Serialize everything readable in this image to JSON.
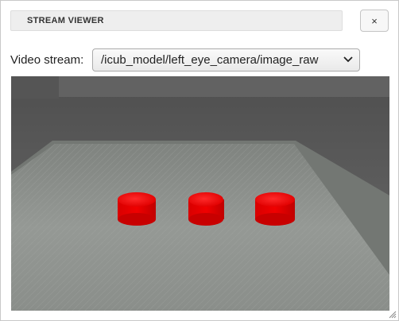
{
  "window": {
    "title": "STREAM VIEWER",
    "close_label": "×"
  },
  "stream": {
    "label": "Video stream:",
    "selected": "/icub_model/left_eye_camera/image_raw"
  },
  "colors": {
    "cylinder_red": "#e00000",
    "floor_gray": "#5e5e5e",
    "platform_gray": "#8c908c"
  },
  "icons": {
    "close": "close-icon",
    "dropdown": "chevron-down-icon",
    "resize": "resize-grip-icon"
  }
}
